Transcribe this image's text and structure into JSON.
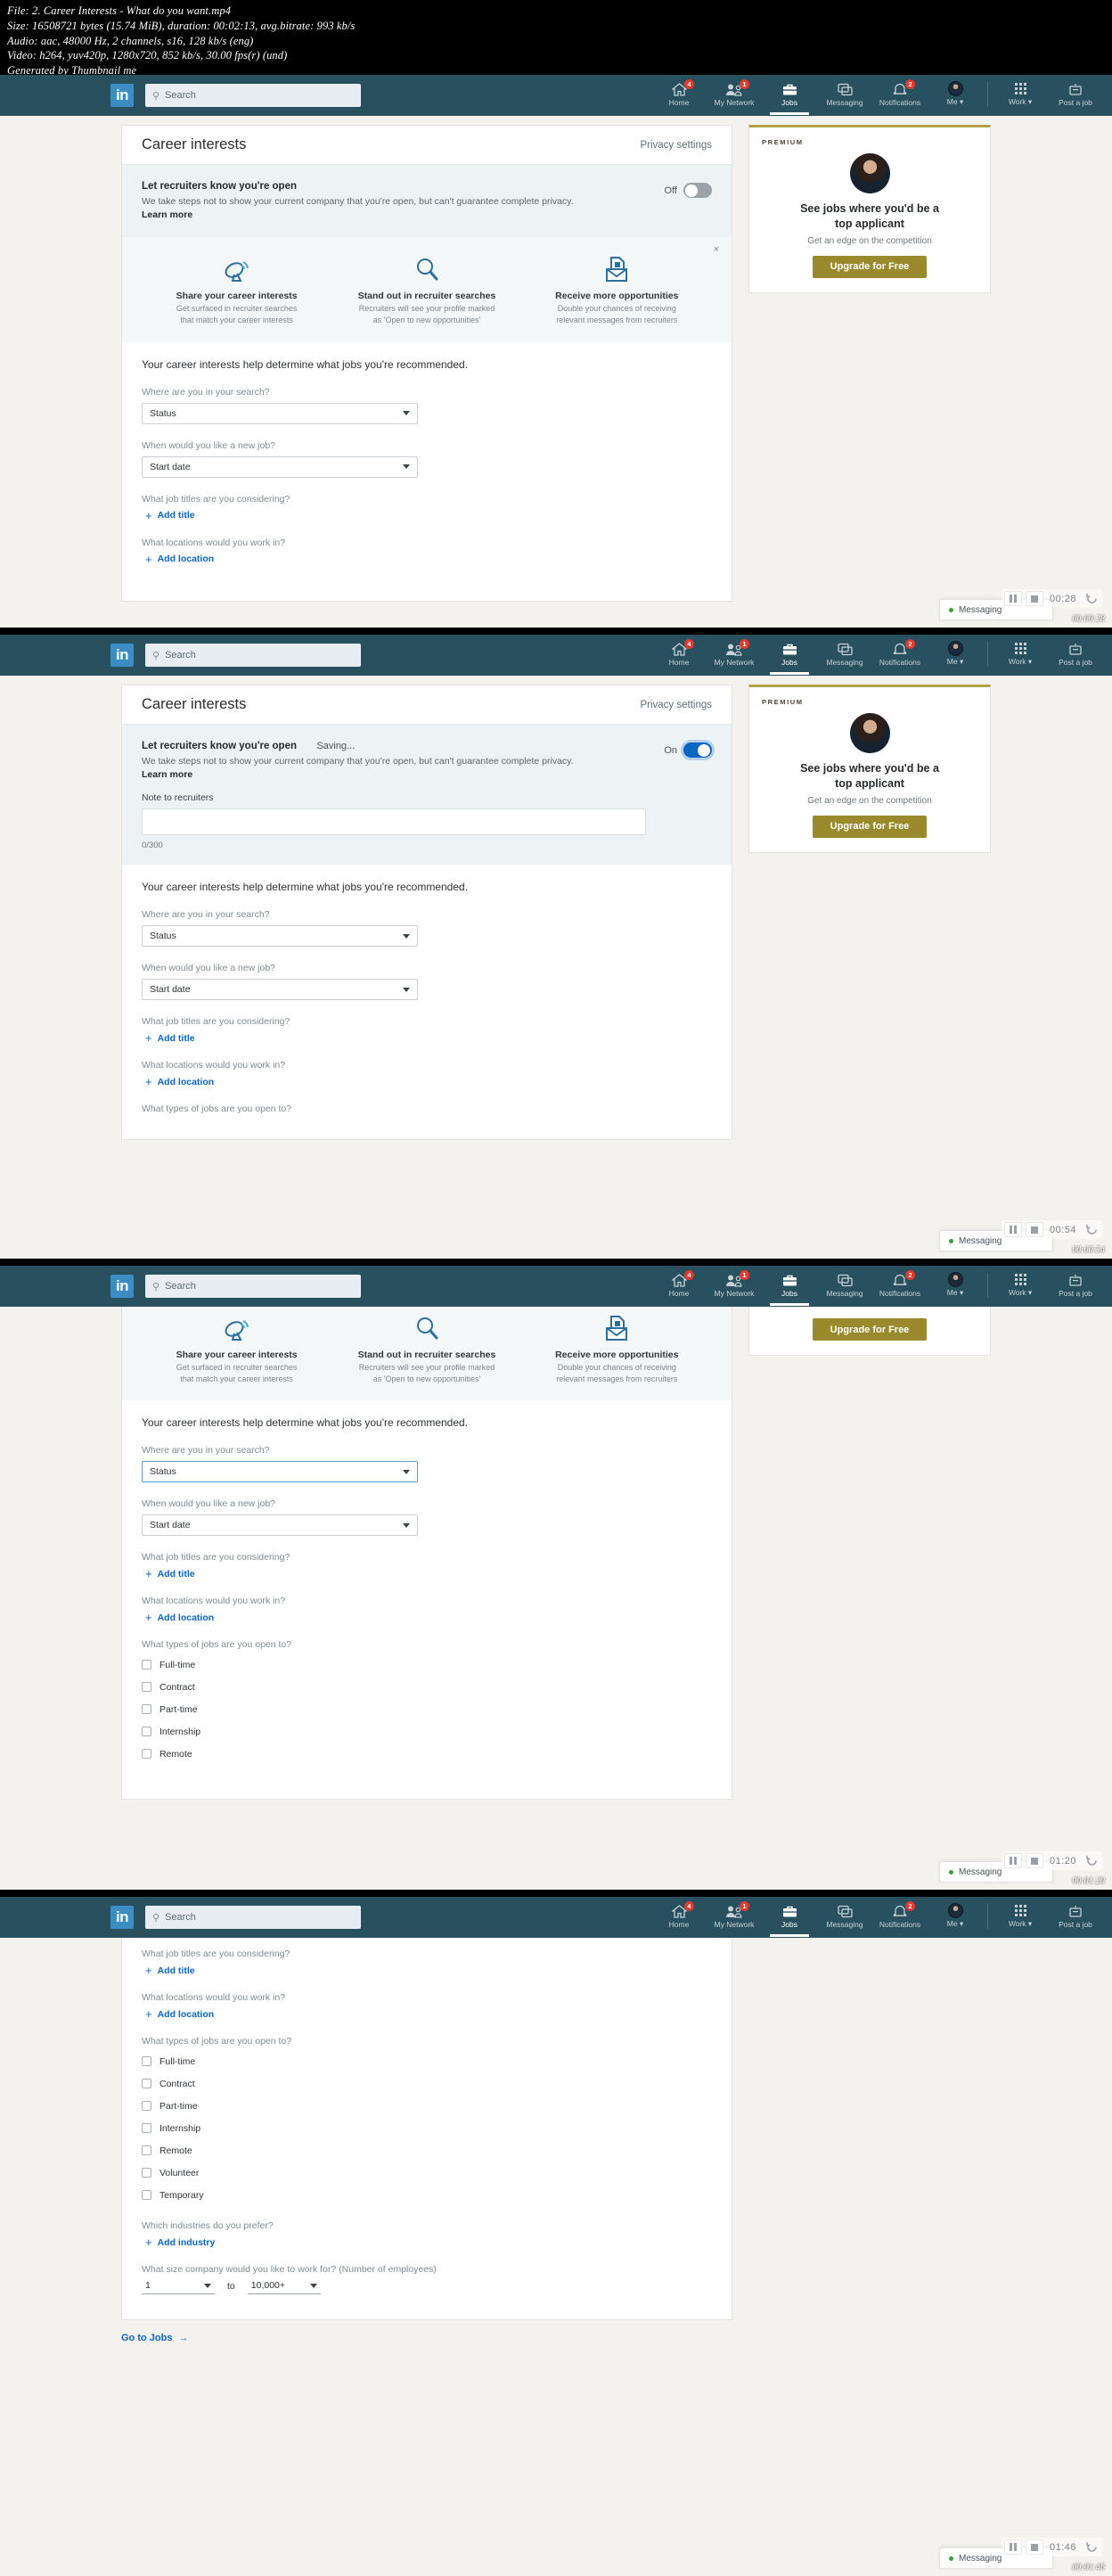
{
  "fileinfo": {
    "line1": "File: 2. Career Interests - What do you want.mp4",
    "line2": "Size: 16508721 bytes (15.74 MiB), duration: 00:02:13, avg.bitrate: 993 kb/s",
    "line3": "Audio: aac, 48000 Hz, 2 channels, s16, 128 kb/s (eng)",
    "line4": "Video: h264, yuv420p, 1280x720, 852 kb/s, 30.00 fps(r) (und)",
    "line5": "Generated by Thumbnail me"
  },
  "nav": {
    "logo": "in",
    "search_placeholder": "Search",
    "search_icon": "search-icon",
    "items": [
      {
        "label": "Home",
        "badge": "4",
        "icon": "home-icon"
      },
      {
        "label": "My Network",
        "badge": "1",
        "icon": "network-icon"
      },
      {
        "label": "Jobs",
        "badge": "",
        "icon": "briefcase-icon"
      },
      {
        "label": "Messaging",
        "badge": "",
        "icon": "messaging-icon"
      },
      {
        "label": "Notifications",
        "badge": "2",
        "icon": "bell-icon"
      },
      {
        "label": "Me ▾",
        "badge": "",
        "icon": "avatar-icon"
      }
    ],
    "items_right": [
      {
        "label": "Work ▾",
        "icon": "grid-icon"
      },
      {
        "label": "Post a job",
        "icon": "post-job-icon"
      }
    ]
  },
  "card": {
    "title": "Career interests",
    "privacy_settings": "Privacy settings"
  },
  "recruiters": {
    "title": "Let recruiters know you're open",
    "saving": "Saving...",
    "desc_a": "We take steps not to show your current company that you're open, but can't guarantee complete",
    "desc_b": "privacy. ",
    "learn_more": "Learn more",
    "toggle_off": "Off",
    "toggle_on": "On",
    "note_label": "Note to recruiters",
    "note_value": "",
    "counter": "0/300"
  },
  "features": {
    "close": "×",
    "items": [
      {
        "icon": "satellite-dish-icon",
        "title": "Share your career interests",
        "line1": "Get surfaced in recruiter searches",
        "line2": "that match your career interests"
      },
      {
        "icon": "magnifier-icon",
        "title": "Stand out in recruiter searches",
        "line1": "Recruiters will see your profile marked",
        "line2": "as 'Open to new opportunities'"
      },
      {
        "icon": "envelope-document-icon",
        "title": "Receive more opportunities",
        "line1": "Double your chances of receiving",
        "line2": "relevant messages from recruiters"
      }
    ]
  },
  "form": {
    "lead": "Your career interests help determine what jobs you're recommended.",
    "q_status": "Where are you in your search?",
    "v_status": "Status",
    "q_startdate": "When would you like a new job?",
    "v_startdate": "Start date",
    "q_titles": "What job titles are you considering?",
    "add_title": "Add title",
    "q_locations": "What locations would you work in?",
    "add_location": "Add location",
    "q_jobtypes": "What types of jobs are you open to?",
    "jobtypes": [
      "Full-time",
      "Contract",
      "Part-time",
      "Internship",
      "Remote",
      "Volunteer",
      "Temporary"
    ],
    "q_industries": "Which industries do you prefer?",
    "add_industry": "Add industry",
    "q_size": "What size company would you like to work for? (Number of employees)",
    "size_min": "1",
    "size_to": "to",
    "size_max": "10,000+",
    "go_to_jobs": "Go to Jobs",
    "go_to_jobs_arrow": "→"
  },
  "premium": {
    "label": "PREMIUM",
    "headline_1": "See jobs where you'd be a",
    "headline_2": "top applicant",
    "sub": "Get an edge on the competition",
    "cta": "Upgrade for Free"
  },
  "messaging": {
    "label": "Messaging"
  },
  "video": {
    "pause_icon": "pause-icon",
    "stop_icon": "stop-icon",
    "refresh_icon": "refresh-icon",
    "panels": [
      {
        "time": "00:28",
        "stamp": "00:00:28"
      },
      {
        "time": "00:54",
        "stamp": "00:00:54"
      },
      {
        "time": "01:20",
        "stamp": "00:01:20"
      },
      {
        "time": "01:46",
        "stamp": "00:01:46"
      }
    ]
  },
  "colors": {
    "nav_bg": "#28505f",
    "brand_blue": "#0a66c2",
    "premium_gold": "#9a8a2d",
    "badge_red": "#e23a2e",
    "page_bg": "#f3f2ef"
  }
}
